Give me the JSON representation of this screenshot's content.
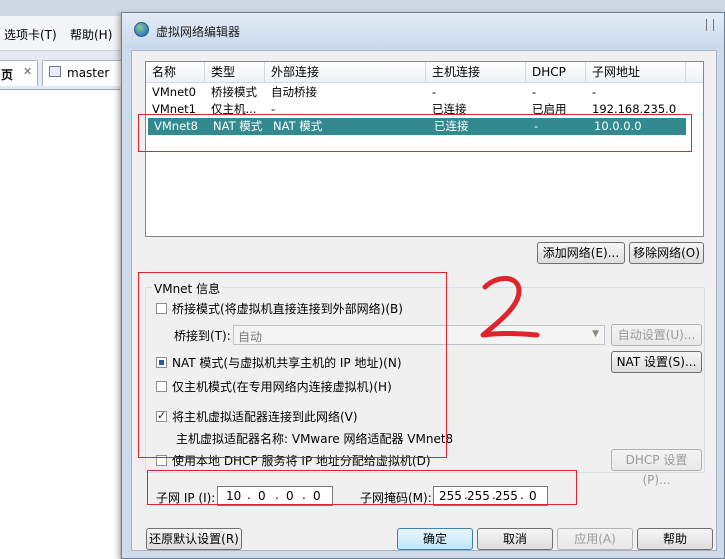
{
  "background": {
    "menu_tabs": "选项卡(T)",
    "menu_help": "帮助(H)",
    "tab_home_fragment": "页",
    "tab_master": "master"
  },
  "dialog": {
    "title": "虚拟网络编辑器",
    "columns": [
      "名称",
      "类型",
      "外部连接",
      "主机连接",
      "DHCP",
      "子网地址"
    ],
    "rows": [
      {
        "name": "VMnet0",
        "type": "桥接模式",
        "external": "自动桥接",
        "host": "-",
        "dhcp": "-",
        "subnet": "-"
      },
      {
        "name": "VMnet1",
        "type": "仅主机...",
        "external": "-",
        "host": "已连接",
        "dhcp": "已启用",
        "subnet": "192.168.235.0"
      },
      {
        "name": "VMnet8",
        "type": "NAT 模式",
        "external": "NAT 模式",
        "host": "已连接",
        "dhcp": "-",
        "subnet": "10.0.0.0"
      }
    ],
    "selected_row": 2,
    "add_network": "添加网络(E)...",
    "remove_network": "移除网络(O)",
    "vmnet_info": "VMnet 信息",
    "bridge_mode": "桥接模式(将虚拟机直接连接到外部网络)(B)",
    "bridge_to_label": "桥接到(T):",
    "bridge_to_value": "自动",
    "auto_settings": "自动设置(U)...",
    "nat_mode": "NAT 模式(与虚拟机共享主机的 IP 地址)(N)",
    "nat_settings": "NAT 设置(S)...",
    "host_only": "仅主机模式(在专用网络内连接虚拟机)(H)",
    "connect_adapter": "将主机虚拟适配器连接到此网络(V)",
    "adapter_name": "主机虚拟适配器名称: VMware 网络适配器 VMnet8",
    "use_dhcp": "使用本地 DHCP 服务将 IP 地址分配给虚拟机(D)",
    "dhcp_settings": "DHCP 设置(P)...",
    "subnet_ip_label": "子网 IP (I):",
    "subnet_ip": [
      "10",
      "0",
      "0",
      "0"
    ],
    "subnet_mask_label": "子网掩码(M):",
    "subnet_mask": [
      "255",
      "255",
      "255",
      "0"
    ],
    "restore_defaults": "还原默认设置(R)",
    "ok": "确定",
    "cancel": "取消",
    "apply": "应用(A)",
    "help": "帮助"
  },
  "annotation": {
    "handwritten_number": "2",
    "color": "#e0242b"
  }
}
